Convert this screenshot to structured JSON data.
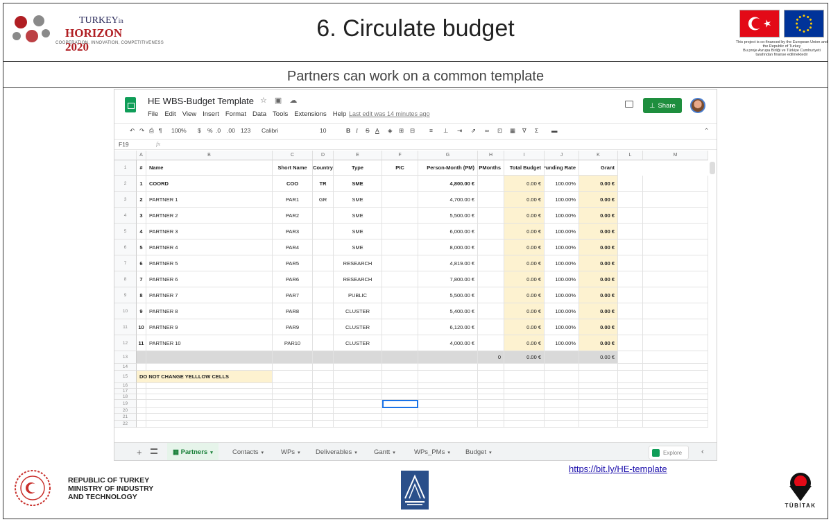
{
  "slide": {
    "title": "6. Circulate budget",
    "subtitle": "Partners can work on a common template",
    "link": "https://bit.ly/HE-template"
  },
  "logos": {
    "left_line1": "TURKEY",
    "left_line1_small": "in",
    "left_line2": "HORIZON 2020",
    "left_line3": "COOPERATION, INNOVATION, COMPETITIVENESS",
    "eu_note_en": "This project is co-financed by the European Union and the Republic of Turkey",
    "eu_note_tr": "Bu proje Avrupa Birliği ve Türkiye Cumhuriyeti tarafından finanse edilmektedir",
    "ministry": [
      "REPUBLIC OF TURKEY",
      "MINISTRY OF INDUSTRY",
      "AND TECHNOLOGY"
    ],
    "tubitak": "TÜBİTAK",
    "colors": {
      "flag_tr": "#e30a17",
      "flag_eu": "#003399",
      "eu_star": "#ffcc00",
      "horizon_red": "#b01e23"
    }
  },
  "app": {
    "doc_title": "HE WBS-Budget Template",
    "menus": [
      "File",
      "Edit",
      "View",
      "Insert",
      "Format",
      "Data",
      "Tools",
      "Extensions",
      "Help"
    ],
    "last_edit": "Last edit was 14 minutes ago",
    "share_label": "Share",
    "toolbar": {
      "zoom": "100%",
      "currency": "$",
      "percent": "%",
      "dec_less": ".0",
      "dec_more": ".00",
      "format": "123",
      "font": "Calibri",
      "font_size": "10",
      "bold": "B",
      "italic": "I",
      "strike": "S",
      "text_color": "A"
    },
    "cell_ref": "F19",
    "fx": "fx",
    "accent": "#1e8e3e"
  },
  "grid": {
    "col_letters": [
      "A",
      "B",
      "C",
      "D",
      "E",
      "F",
      "G",
      "H",
      "I",
      "J",
      "K",
      "L",
      "M"
    ],
    "headers": [
      "#",
      "Name",
      "Short Name",
      "Country",
      "Type",
      "PIC",
      "Person-Month (PM)",
      "PMonths",
      "Total Budget",
      "Funding Rate",
      "Grant"
    ],
    "row_numbers": [
      "1",
      "2",
      "3",
      "4",
      "5",
      "6",
      "7",
      "8",
      "9",
      "10",
      "11",
      "12",
      "13",
      "14",
      "15",
      "16",
      "17",
      "18",
      "19",
      "20",
      "21",
      "22"
    ],
    "rows": [
      [
        "1",
        "COORD",
        "COO",
        "TR",
        "SME",
        "",
        "4,800.00 €",
        "",
        "0.00 €",
        "100.00%",
        "0.00 €"
      ],
      [
        "2",
        "PARTNER 1",
        "PAR1",
        "GR",
        "SME",
        "",
        "4,700.00 €",
        "",
        "0.00 €",
        "100.00%",
        "0.00 €"
      ],
      [
        "3",
        "PARTNER 2",
        "PAR2",
        "",
        "SME",
        "",
        "5,500.00 €",
        "",
        "0.00 €",
        "100.00%",
        "0.00 €"
      ],
      [
        "4",
        "PARTNER 3",
        "PAR3",
        "",
        "SME",
        "",
        "6,000.00 €",
        "",
        "0.00 €",
        "100.00%",
        "0.00 €"
      ],
      [
        "5",
        "PARTNER 4",
        "PAR4",
        "",
        "SME",
        "",
        "8,000.00 €",
        "",
        "0.00 €",
        "100.00%",
        "0.00 €"
      ],
      [
        "6",
        "PARTNER 5",
        "PAR5",
        "",
        "RESEARCH",
        "",
        "4,819.00 €",
        "",
        "0.00 €",
        "100.00%",
        "0.00 €"
      ],
      [
        "7",
        "PARTNER 6",
        "PAR6",
        "",
        "RESEARCH",
        "",
        "7,800.00 €",
        "",
        "0.00 €",
        "100.00%",
        "0.00 €"
      ],
      [
        "8",
        "PARTNER 7",
        "PAR7",
        "",
        "PUBLIC",
        "",
        "5,500.00 €",
        "",
        "0.00 €",
        "100.00%",
        "0.00 €"
      ],
      [
        "9",
        "PARTNER 8",
        "PAR8",
        "",
        "CLUSTER",
        "",
        "5,400.00 €",
        "",
        "0.00 €",
        "100.00%",
        "0.00 €"
      ],
      [
        "10",
        "PARTNER 9",
        "PAR9",
        "",
        "CLUSTER",
        "",
        "6,120.00 €",
        "",
        "0.00 €",
        "100.00%",
        "0.00 €"
      ],
      [
        "11",
        "PARTNER 10",
        "PAR10",
        "",
        "CLUSTER",
        "",
        "4,000.00 €",
        "",
        "0.00 €",
        "100.00%",
        "0.00 €"
      ]
    ],
    "totals": {
      "pmonths": "0",
      "total_budget": "0.00 €",
      "grant": "0.00 €"
    },
    "note": "DO NOT CHANGE YELLLOW CELLS",
    "colors": {
      "yellow": "#fdf2d0",
      "total_row": "#d9d9d9"
    }
  },
  "tabs": [
    "Partners",
    "Contacts",
    "WPs",
    "Deliverables",
    "Gantt",
    "WPs_PMs",
    "Budget"
  ],
  "active_tab": "Partners",
  "explore_label": "Explore"
}
